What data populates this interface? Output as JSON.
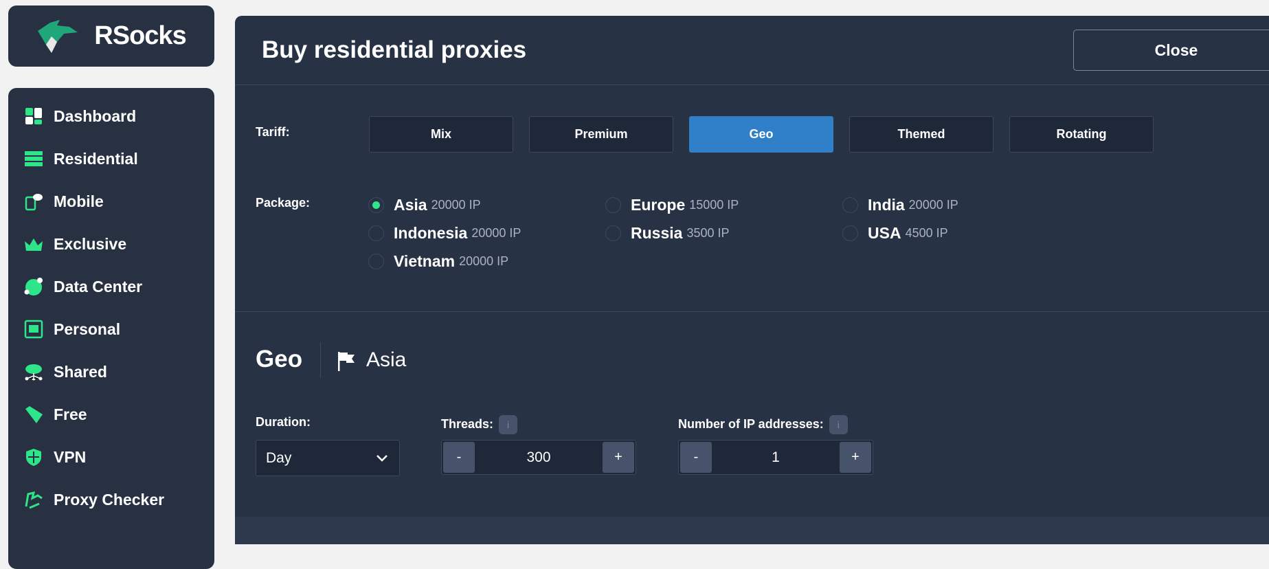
{
  "brand": {
    "name": "RSocks"
  },
  "sidebar": {
    "items": [
      {
        "label": "Dashboard",
        "icon": "dashboard-icon"
      },
      {
        "label": "Residential",
        "icon": "server-icon"
      },
      {
        "label": "Mobile",
        "icon": "mobile-cloud-icon"
      },
      {
        "label": "Exclusive",
        "icon": "crown-icon"
      },
      {
        "label": "Data Center",
        "icon": "globe-pin-icon"
      },
      {
        "label": "Personal",
        "icon": "safe-icon"
      },
      {
        "label": "Shared",
        "icon": "cloud-network-icon"
      },
      {
        "label": "Free",
        "icon": "free-tag-icon"
      },
      {
        "label": "VPN",
        "icon": "shield-icon"
      },
      {
        "label": "Proxy Checker",
        "icon": "proxy-checker-icon"
      }
    ]
  },
  "header": {
    "title": "Buy residential proxies",
    "close_label": "Close"
  },
  "tariff": {
    "label": "Tariff:",
    "options": [
      "Mix",
      "Premium",
      "Geo",
      "Themed",
      "Rotating"
    ],
    "selected": "Geo"
  },
  "package": {
    "label": "Package:",
    "options": [
      {
        "name": "Asia",
        "ips": "20000 IP",
        "selected": true
      },
      {
        "name": "Indonesia",
        "ips": "20000 IP"
      },
      {
        "name": "Vietnam",
        "ips": "20000 IP"
      },
      {
        "name": "Europe",
        "ips": "15000 IP"
      },
      {
        "name": "Russia",
        "ips": "3500 IP"
      },
      {
        "name": "India",
        "ips": "20000 IP"
      },
      {
        "name": "USA",
        "ips": "4500 IP"
      }
    ]
  },
  "summary": {
    "tariff": "Geo",
    "package": "Asia"
  },
  "duration": {
    "label": "Duration:",
    "value": "Day"
  },
  "threads": {
    "label": "Threads:",
    "value": "300",
    "info": "i"
  },
  "ip_count": {
    "label": "Number of IP addresses:",
    "value": "1",
    "info": "i"
  },
  "stepper": {
    "minus": "-",
    "plus": "+"
  },
  "colors": {
    "accent": "#2ee58a",
    "selected_tab": "#2f80c8",
    "panel": "#283245"
  }
}
